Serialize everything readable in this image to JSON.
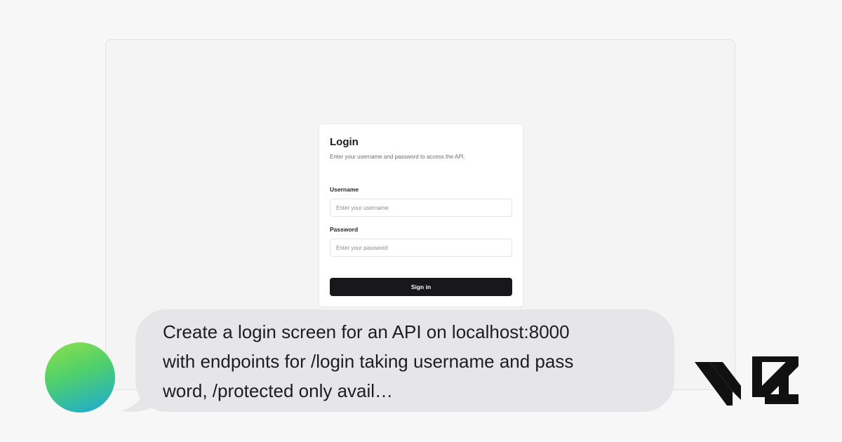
{
  "login": {
    "title": "Login",
    "subtitle": "Enter your username and password to access the API.",
    "username_label": "Username",
    "username_placeholder": "Enter your username",
    "password_label": "Password",
    "password_placeholder": "Enter your password",
    "signin_label": "Sign in"
  },
  "chat": {
    "message": "Create a login screen for an API on localhost:8000\nwith endpoints for /login taking username and pass\nword, /protected only avail…"
  },
  "icons": {
    "avatar": "gradient-avatar",
    "brand": "v0-logo"
  },
  "colors": {
    "button": "#18181b",
    "bubble": "#e6e6e8",
    "avatar_start": "#8de04a",
    "avatar_end": "#1aa9d8"
  }
}
